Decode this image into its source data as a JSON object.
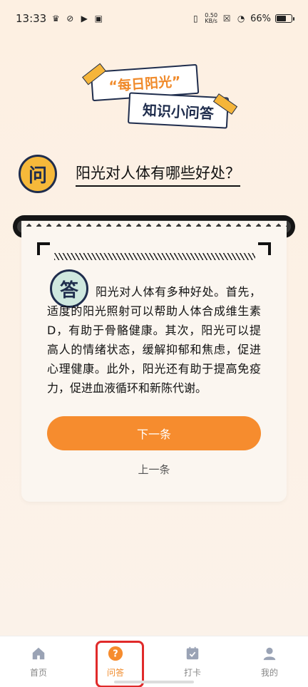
{
  "status_bar": {
    "time": "13:33",
    "net_speed_value": "0.50",
    "net_speed_unit": "KB/s",
    "battery": "66%"
  },
  "banner": {
    "line1": "“每日阳光”",
    "line2": "知识小问答"
  },
  "question": {
    "badge": "问",
    "text": "阳光对人体有哪些好处？"
  },
  "answer": {
    "badge": "答",
    "text": "阳光对人体有多种好处。首先，适度的阳光照射可以帮助人体合成维生素D，有助于骨骼健康。其次，阳光可以提高人的情绪状态，缓解抑郁和焦虑，促进心理健康。此外，阳光还有助于提高免疫力，促进血液循环和新陈代谢。"
  },
  "buttons": {
    "next": "下一条",
    "prev": "上一条"
  },
  "nav": {
    "items": [
      {
        "label": "首页",
        "icon": "home-icon"
      },
      {
        "label": "问答",
        "icon": "question-icon",
        "active": true
      },
      {
        "label": "打卡",
        "icon": "calendar-check-icon"
      },
      {
        "label": "我的",
        "icon": "user-icon"
      }
    ]
  },
  "colors": {
    "accent": "#f68c2e",
    "navy": "#1f2d4d",
    "highlight": "#e02a2a"
  }
}
